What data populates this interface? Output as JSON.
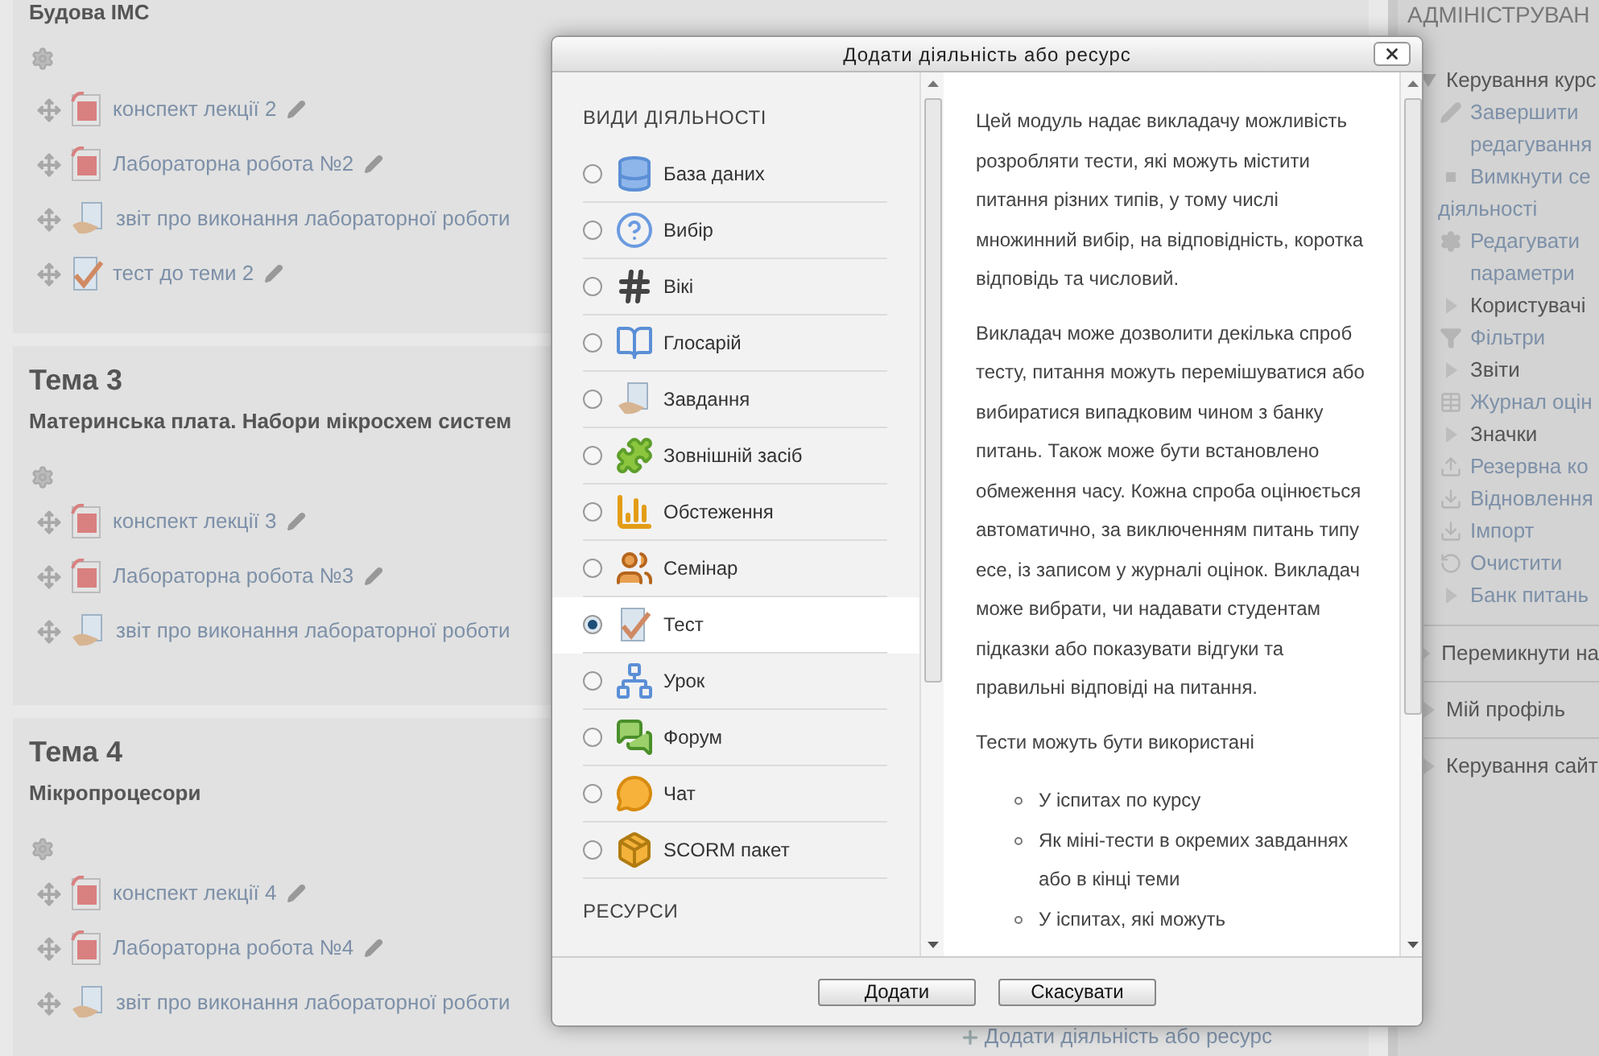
{
  "course": {
    "sections": [
      {
        "summary": "Будова ІМС",
        "items": [
          {
            "kind": "pdf",
            "label": "конспект лекції 2",
            "edit_icon": true
          },
          {
            "kind": "pdf",
            "label": "Лабораторна робота №2",
            "edit_icon": true
          },
          {
            "kind": "assign",
            "label": "звіт про виконання лабораторної роботи",
            "edit_icon": false
          },
          {
            "kind": "quiz",
            "label": "тест до теми 2",
            "edit_icon": true
          }
        ]
      },
      {
        "title": "Тема 3",
        "summary": "Материнська плата. Набори мікросхем систем",
        "items": [
          {
            "kind": "pdf",
            "label": "конспект лекції 3",
            "edit_icon": true
          },
          {
            "kind": "pdf",
            "label": "Лабораторна робота №3",
            "edit_icon": true
          },
          {
            "kind": "assign",
            "label": "звіт про виконання лабораторної роботи",
            "edit_icon": false
          }
        ]
      },
      {
        "title": "Тема 4",
        "summary": "Мікропроцесори",
        "items": [
          {
            "kind": "pdf",
            "label": "конспект лекції 4",
            "edit_icon": true
          },
          {
            "kind": "pdf",
            "label": "Лабораторна робота №4",
            "edit_icon": true
          },
          {
            "kind": "assign",
            "label": "звіт про виконання лабораторної роботи",
            "edit_icon": false
          }
        ],
        "add_link": "Додати діяльність або ресурс"
      }
    ]
  },
  "admin": {
    "title": "АДМІНІСТРУВАН",
    "nodes": [
      {
        "label": "Керування курс",
        "expanded": true,
        "children": [
          {
            "kind": "edit",
            "link": true,
            "label": "Завершити редагування"
          },
          {
            "kind": "bullet",
            "link": true,
            "label": "Вимкнути се",
            "label_cont": "діяльності"
          },
          {
            "kind": "gear",
            "link": true,
            "label": "Редагувати параметри"
          },
          {
            "kind": "branch",
            "link": false,
            "label": "Користувачі"
          },
          {
            "kind": "filter",
            "link": true,
            "label": "Фільтри"
          },
          {
            "kind": "branch",
            "link": false,
            "label": "Звіти"
          },
          {
            "kind": "grades",
            "link": true,
            "label": "Журнал оцін"
          },
          {
            "kind": "branch",
            "link": false,
            "label": "Значки"
          },
          {
            "kind": "backup",
            "link": true,
            "label": "Резервна ко"
          },
          {
            "kind": "restore",
            "link": true,
            "label": "Відновлення"
          },
          {
            "kind": "restore",
            "link": true,
            "label": "Імпорт"
          },
          {
            "kind": "reset",
            "link": true,
            "label": "Очистити"
          },
          {
            "kind": "branch",
            "link": true,
            "label": "Банк питань"
          }
        ]
      },
      {
        "label": "Перемикнути на",
        "expanded": false
      },
      {
        "label": "Мій профіль",
        "expanded": false
      },
      {
        "label": "Керування сайт",
        "expanded": false
      }
    ]
  },
  "dialog": {
    "title": "Додати діяльність або ресурс",
    "groups": [
      {
        "heading": "ВИДИ ДІЯЛЬНОСТІ",
        "options": [
          {
            "kind": "database",
            "label": "База даних",
            "selected": false
          },
          {
            "kind": "choice",
            "label": "Вибір",
            "selected": false
          },
          {
            "kind": "wiki",
            "label": "Вікі",
            "selected": false
          },
          {
            "kind": "glossary",
            "label": "Глосарій",
            "selected": false
          },
          {
            "kind": "assign",
            "label": "Завдання",
            "selected": false
          },
          {
            "kind": "lti",
            "label": "Зовнішній засіб",
            "selected": false
          },
          {
            "kind": "survey",
            "label": "Обстеження",
            "selected": false
          },
          {
            "kind": "workshop",
            "label": "Семінар",
            "selected": false
          },
          {
            "kind": "quiz",
            "label": "Тест",
            "selected": true
          },
          {
            "kind": "lesson",
            "label": "Урок",
            "selected": false
          },
          {
            "kind": "forum",
            "label": "Форум",
            "selected": false
          },
          {
            "kind": "chat",
            "label": "Чат",
            "selected": false
          },
          {
            "kind": "scorm",
            "label": "SCORM пакет",
            "selected": false
          }
        ]
      },
      {
        "heading": "РЕСУРСИ"
      }
    ],
    "description": {
      "paragraphs": [
        "Цей модуль надає викладачу можливість розробляти тести, які можуть містити питання різних типів, у тому числі множинний вибір, на відповідність, коротка відповідь та числовий.",
        "Викладач може дозволити декілька спроб тесту, питання можуть перемішуватися або вибиратися випадковим чином з банку питань. Також може бути встановлено обмеження часу. Кожна спроба оцінюється автоматично, за виключенням питань типу есе, із записом у журналі оцінок. Викладач може вибрати, чи надавати студентам підказки або показувати відгуки та правильні відповіді на питання.",
        "Тести можуть бути використані"
      ],
      "bullets": [
        "У іспитах по курсу",
        "Як міні-тести в окремих завданнях або в кінці теми",
        "У іспитах, які можуть"
      ]
    },
    "buttons": [
      "Додати",
      "Скасувати"
    ]
  }
}
